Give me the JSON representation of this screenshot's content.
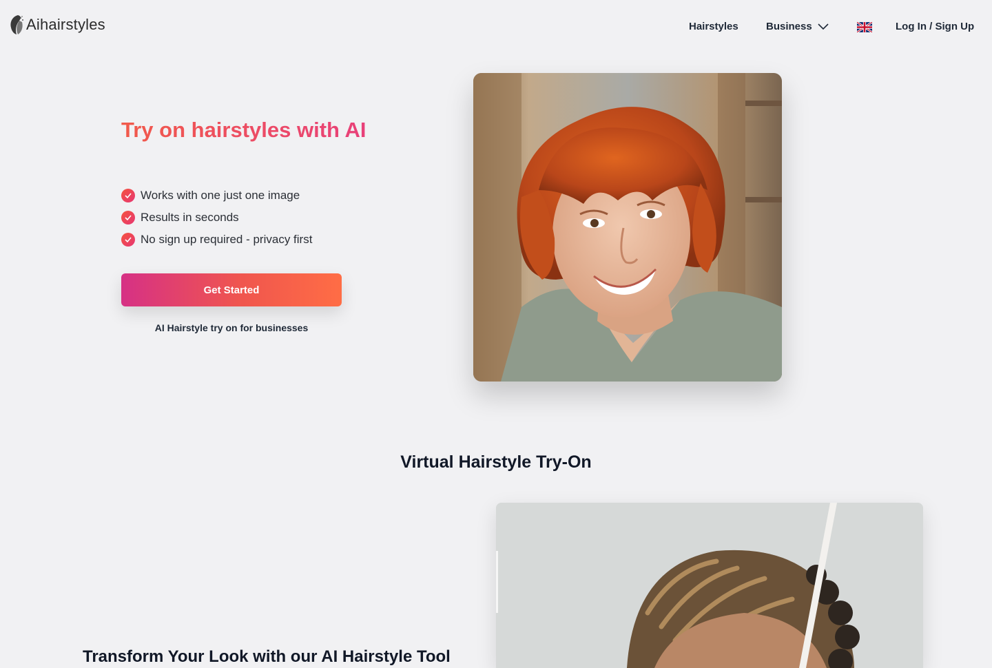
{
  "header": {
    "logo_text": "Aihairstyles",
    "nav": {
      "hairstyles": "Hairstyles",
      "business": "Business",
      "login": "Log In / Sign Up"
    },
    "language_icon": "uk-flag-icon"
  },
  "hero": {
    "title": "Try on hairstyles with AI",
    "features": [
      "Works with one just one image",
      "Results in seconds",
      "No sign up required - privacy first"
    ],
    "cta_label": "Get Started",
    "business_link": "AI Hairstyle try on for businesses"
  },
  "section2": {
    "title": "Virtual Hairstyle Try-On",
    "subtitle": "Transform Your Look with our AI Hairstyle Tool"
  },
  "colors": {
    "background": "#f1f1f3",
    "accent_start": "#d63185",
    "accent_end": "#ff6d45",
    "title_gradient_start": "#f15a4a",
    "title_gradient_end": "#e8407a"
  }
}
